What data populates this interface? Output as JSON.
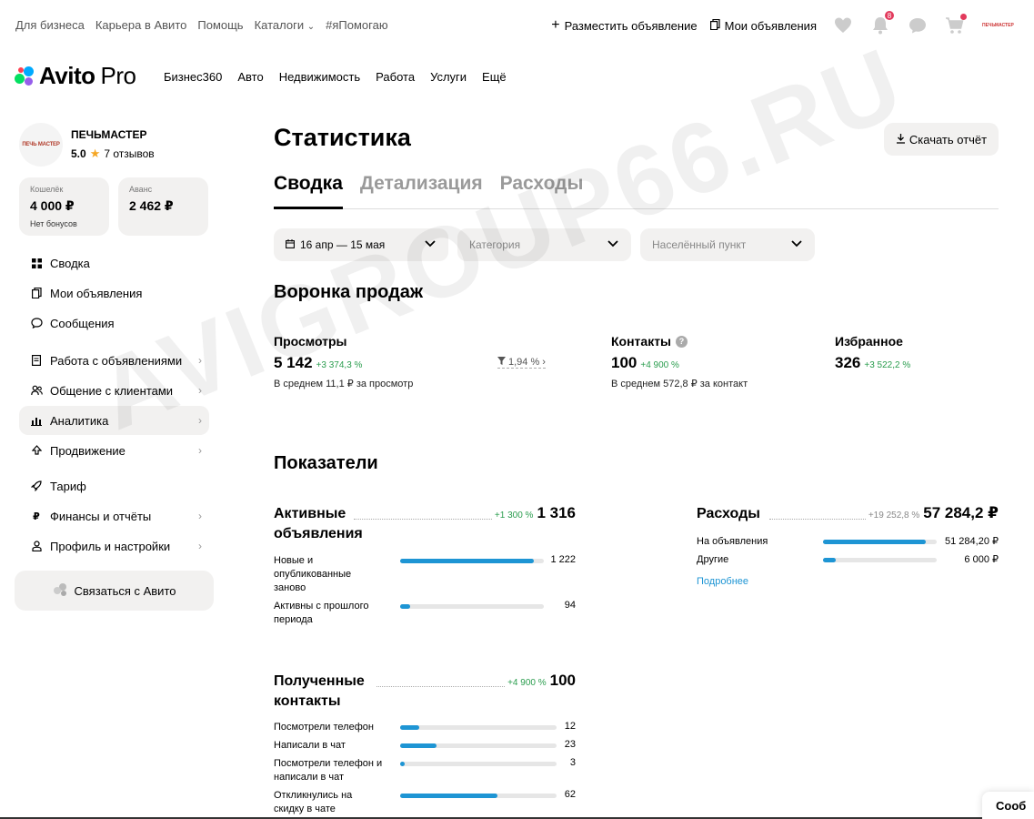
{
  "topbar": {
    "links": [
      "Для бизнеса",
      "Карьера в Авито",
      "Помощь",
      "Каталоги",
      "#яПомогаю"
    ],
    "post_ad": "Разместить объявление",
    "my_ads": "Мои объявления",
    "notifications_count": "8",
    "mini_logo": "ПЕЧЬМАСТЕР"
  },
  "navbar": {
    "logo": "Avito",
    "logo_suffix": "Pro",
    "links": [
      "Бизнес360",
      "Авто",
      "Недвижимость",
      "Работа",
      "Услуги",
      "Ещё"
    ]
  },
  "seller": {
    "name": "ПЕЧЬМАСТЕР",
    "rating": "5.0",
    "reviews": "7 отзывов",
    "avatar_text": "ПЕЧЬ МАСТЕР"
  },
  "wallet": {
    "label": "Кошелёк",
    "value": "4 000 ₽",
    "note": "Нет бонусов"
  },
  "advance": {
    "label": "Аванс",
    "value": "2 462 ₽"
  },
  "menu": [
    {
      "label": "Сводка",
      "icon": "grid-icon"
    },
    {
      "label": "Мои объявления",
      "icon": "ads-icon"
    },
    {
      "label": "Сообщения",
      "icon": "chat-icon"
    },
    {
      "label": "Работа с объявлениями",
      "icon": "document-icon"
    },
    {
      "label": "Общение с клиентами",
      "icon": "users-icon"
    },
    {
      "label": "Аналитика",
      "icon": "chart-icon"
    },
    {
      "label": "Продвижение",
      "icon": "promo-icon"
    },
    {
      "label": "Тариф",
      "icon": "rocket-icon"
    },
    {
      "label": "Финансы и отчёты",
      "icon": "ruble-icon"
    },
    {
      "label": "Профиль и настройки",
      "icon": "profile-icon"
    }
  ],
  "contact_avito": "Связаться с Авито",
  "main": {
    "title": "Статистика",
    "download": "Скачать отчёт",
    "tabs": [
      "Сводка",
      "Детализация",
      "Расходы"
    ],
    "filters": {
      "period": "16 апр — 15 мая",
      "category_placeholder": "Категория",
      "city_placeholder": "Населённый пункт"
    }
  },
  "funnel": {
    "title": "Воронка продаж",
    "views": {
      "label": "Просмотры",
      "value": "5 142",
      "delta": "+3 374,3 %",
      "sub": "В среднем 11,1 ₽ за просмотр"
    },
    "conversion": "1,94 %",
    "contacts": {
      "label": "Контакты",
      "value": "100",
      "delta": "+4 900 %",
      "sub": "В среднем 572,8 ₽ за контакт"
    },
    "favorites": {
      "label": "Избранное",
      "value": "326",
      "delta": "+3 522,2 %"
    }
  },
  "indicators": {
    "title": "Показатели",
    "active_ads": {
      "title": "Активные объявления",
      "delta": "+1 300 %",
      "total": "1 316",
      "rows": [
        {
          "label": "Новые и опубликованные заново",
          "value": "1 222",
          "fraction": 0.93
        },
        {
          "label": "Активны с прошлого периода",
          "value": "94",
          "fraction": 0.07
        }
      ]
    },
    "expenses": {
      "title": "Расходы",
      "delta": "+19 252,8 %",
      "total": "57 284,2 ₽",
      "rows": [
        {
          "label": "На объявления",
          "value": "51 284,20 ₽",
          "fraction": 0.9
        },
        {
          "label": "Другие",
          "value": "6 000 ₽",
          "fraction": 0.11
        }
      ],
      "more": "Подробнее"
    },
    "contacts": {
      "title": "Полученные контакты",
      "delta": "+4 900 %",
      "total": "100",
      "rows": [
        {
          "label": "Посмотрели телефон",
          "value": "12",
          "fraction": 0.12
        },
        {
          "label": "Написали в чат",
          "value": "23",
          "fraction": 0.23
        },
        {
          "label": "Посмотрели телефон и написали в чат",
          "value": "3",
          "fraction": 0.03
        },
        {
          "label": "Откликнулись на скидку в чате",
          "value": "62",
          "fraction": 0.62
        }
      ]
    }
  },
  "chat_tab": "Сооб",
  "watermark": "AVIGROUP66.RU"
}
